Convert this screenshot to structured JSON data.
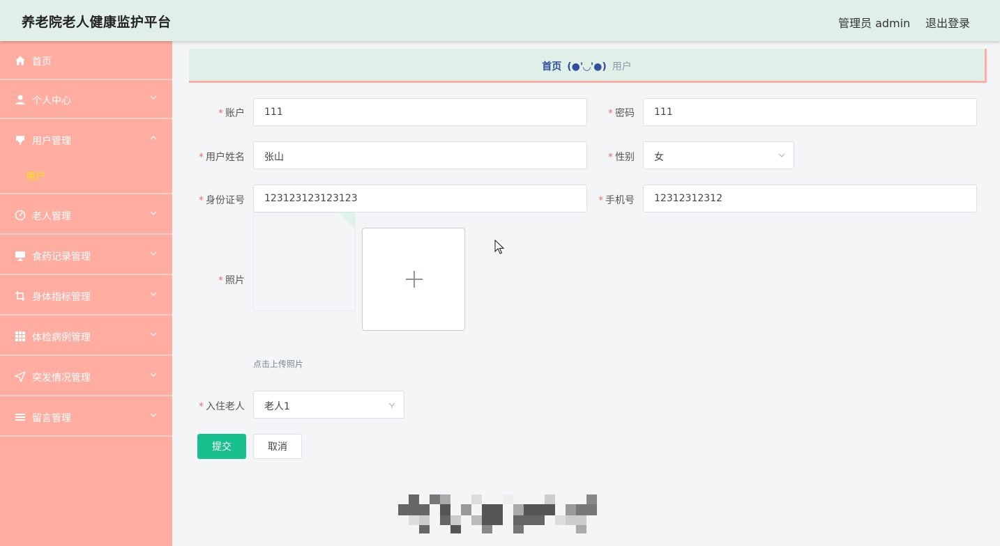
{
  "header": {
    "title": "养老院老人健康监护平台",
    "admin": "管理员 admin",
    "logout": "退出登录"
  },
  "sidebar": {
    "items": [
      {
        "label": "首页",
        "icon": "home-icon"
      },
      {
        "label": "个人中心",
        "icon": "person-icon"
      },
      {
        "label": "用户管理",
        "icon": "user-manage-icon",
        "expanded": true
      },
      {
        "label": "老人管理",
        "icon": "gauge-icon"
      },
      {
        "label": "食药记录管理",
        "icon": "monitor-icon"
      },
      {
        "label": "身体指标管理",
        "icon": "crop-icon"
      },
      {
        "label": "体检病例管理",
        "icon": "grid-icon"
      },
      {
        "label": "突发情况管理",
        "icon": "send-icon"
      },
      {
        "label": "留言管理",
        "icon": "list-icon"
      }
    ],
    "submenu": {
      "label": "用户"
    }
  },
  "breadcrumb": {
    "home": "首页",
    "face": "(●'◡'●)",
    "current": "用户"
  },
  "form": {
    "account": {
      "label": "账户",
      "value": "111"
    },
    "password": {
      "label": "密码",
      "value": "111"
    },
    "name": {
      "label": "用户姓名",
      "value": "张山"
    },
    "gender": {
      "label": "性别",
      "value": "女"
    },
    "id_card": {
      "label": "身份证号",
      "value": "123123123123123"
    },
    "phone": {
      "label": "手机号",
      "value": "12312312312"
    },
    "photo": {
      "label": "照片",
      "tip": "点击上传照片"
    },
    "elder": {
      "label": "入住老人",
      "value": "老人1"
    },
    "submit": "提交",
    "cancel": "取消"
  },
  "colors": {
    "header_bg": "#e0efe8",
    "sidebar_bg": "#ffada1",
    "submenu_active": "#ffe600",
    "submit_bg": "#17c08d",
    "required": "#f56c6c"
  }
}
